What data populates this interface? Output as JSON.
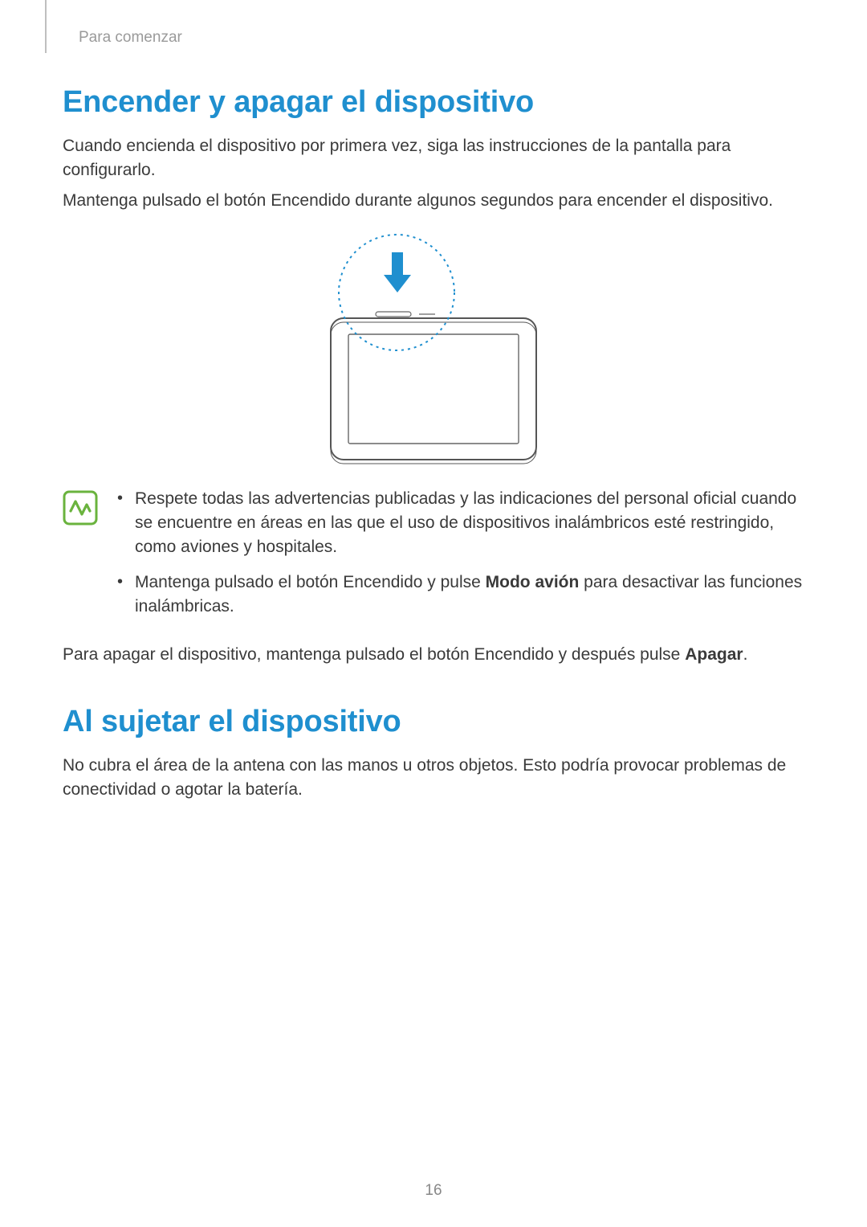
{
  "section_label": "Para comenzar",
  "h1_power": "Encender y apagar el dispositivo",
  "p_power_1": "Cuando encienda el dispositivo por primera vez, siga las instrucciones de la pantalla para configurarlo.",
  "p_power_2": "Mantenga pulsado el botón Encendido durante algunos segundos para encender el dispositivo.",
  "note_bullet_1": "Respete todas las advertencias publicadas y las indicaciones del personal oficial cuando se encuentre en áreas en las que el uso de dispositivos inalámbricos esté restringido, como aviones y hospitales.",
  "note_bullet_2a": "Mantenga pulsado el botón Encendido y pulse ",
  "note_bullet_2b_bold": "Modo avión",
  "note_bullet_2c": " para desactivar las funciones inalámbricas.",
  "p_power_3a": "Para apagar el dispositivo, mantenga pulsado el botón Encendido y después pulse ",
  "p_power_3b_bold": "Apagar",
  "p_power_3c": ".",
  "h1_hold": "Al sujetar el dispositivo",
  "p_hold_1": "No cubra el área de la antena con las manos u otros objetos. Esto podría provocar problemas de conectividad o agotar la batería.",
  "page_number": "16"
}
